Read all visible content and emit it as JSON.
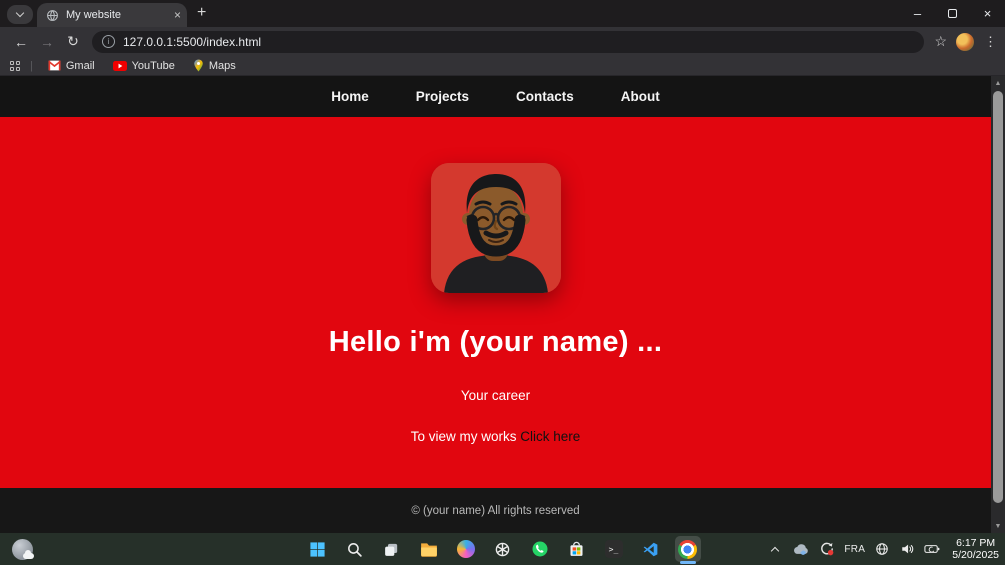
{
  "browser": {
    "tab_title": "My website",
    "url": "127.0.0.1:5500/index.html",
    "bookmarks": [
      {
        "label": "Gmail"
      },
      {
        "label": "YouTube"
      },
      {
        "label": "Maps"
      }
    ]
  },
  "page": {
    "nav": [
      "Home",
      "Projects",
      "Contacts",
      "About"
    ],
    "hero": {
      "heading": "Hello i'm (your name) ...",
      "career": "Your career",
      "works_prefix": "To view my works",
      "works_link": "Click here"
    },
    "footer": "© (your name) All rights reserved"
  },
  "taskbar": {
    "language": "FRA",
    "time": "6:17 PM",
    "date": "5/20/2025"
  },
  "icons": {
    "back": "←",
    "forward": "→",
    "refresh": "↻",
    "info": "i",
    "star": "☆",
    "menu": "⋮",
    "minimize": "–",
    "close": "×",
    "tab_close": "×",
    "new_tab": "+",
    "scroll_up": "▲",
    "scroll_down": "▼",
    "terminal_prompt": ">_"
  },
  "colors": {
    "accent_red": "#e1060f",
    "avatar_red": "#d4392e",
    "nav_black": "#141414",
    "footer_black": "#171717",
    "link_black": "#111111",
    "taskbar_green": "#263029",
    "active_underline": "#71b7f8"
  }
}
